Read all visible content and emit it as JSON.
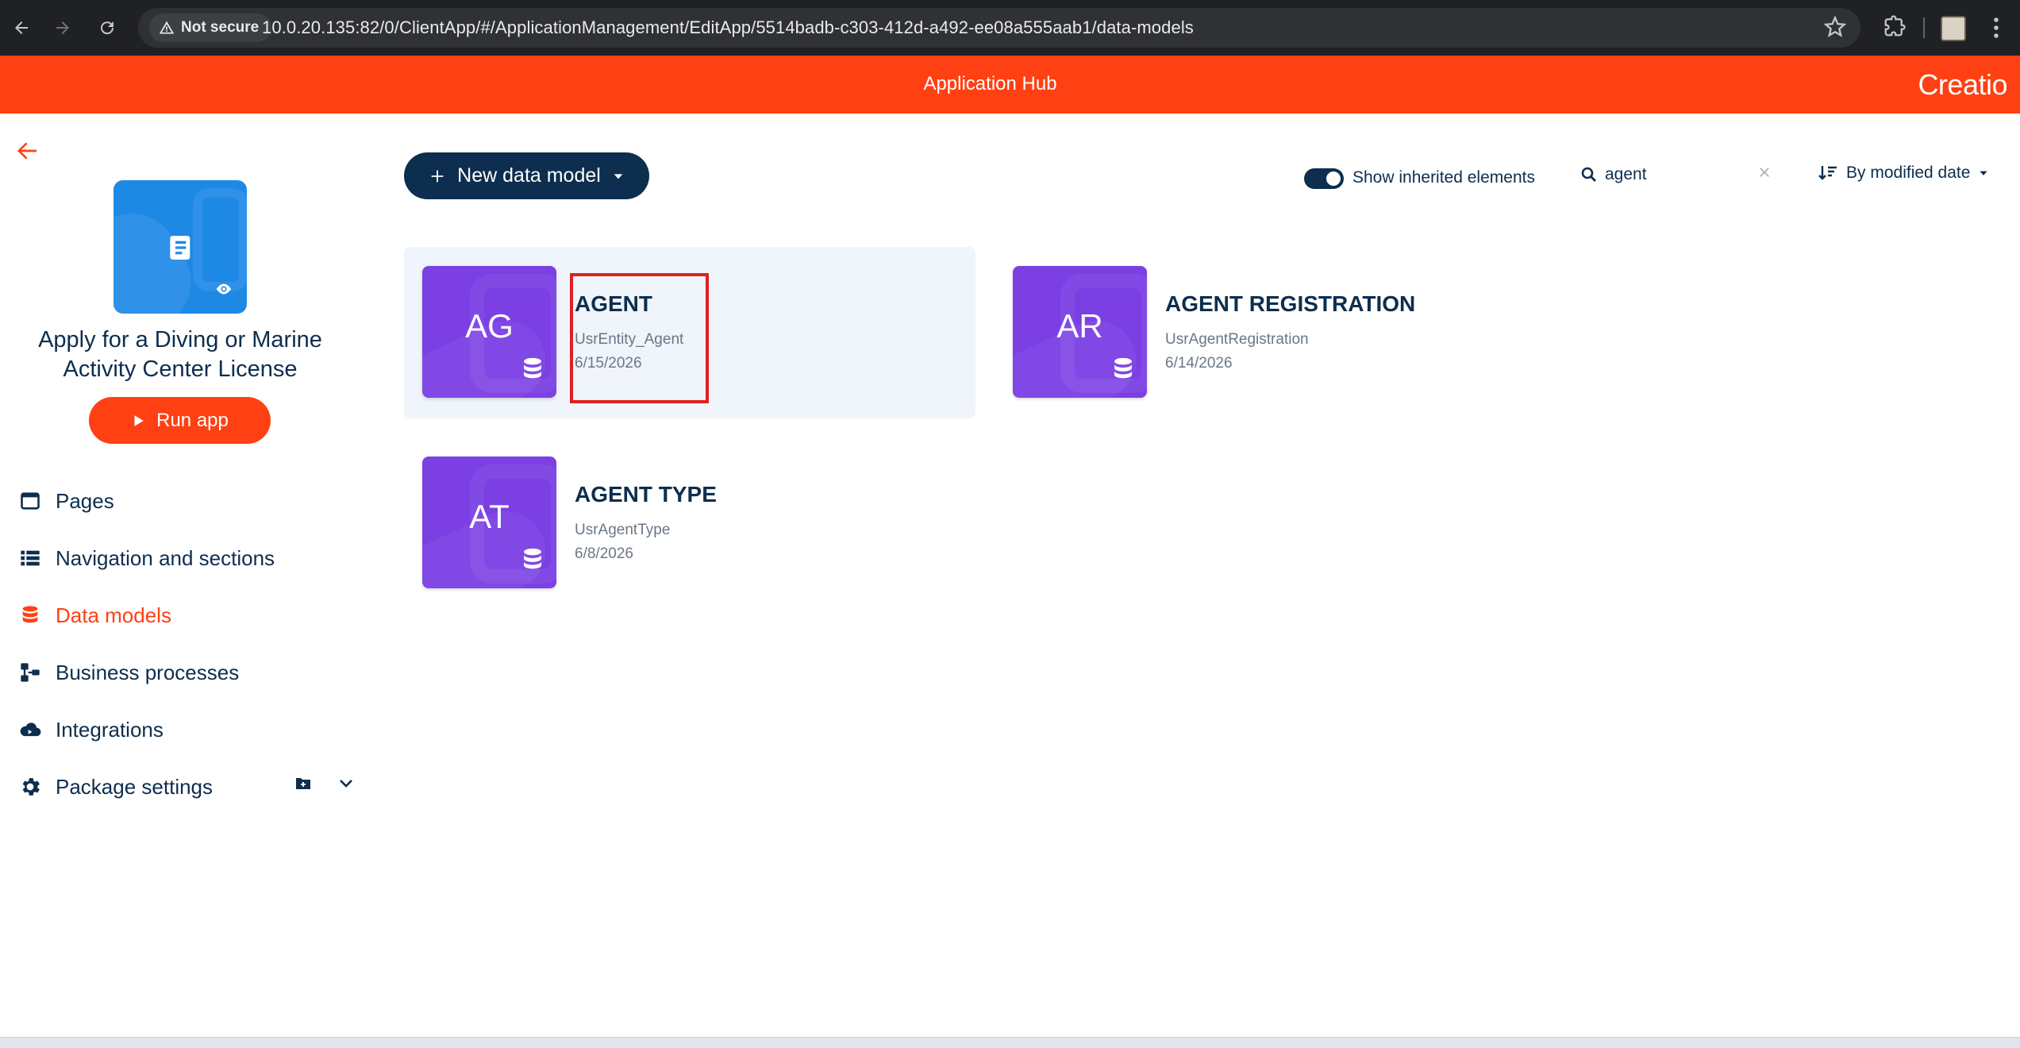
{
  "browser": {
    "security_label": "Not secure",
    "url": "10.0.20.135:82/0/ClientApp/#/ApplicationManagement/EditApp/5514badb-c303-412d-a492-ee08a555aab1/data-models"
  },
  "header": {
    "title": "Application Hub",
    "brand": "Creatio"
  },
  "app": {
    "name": "Apply for a Diving or Marine Activity Center License",
    "run_label": "Run app"
  },
  "sidebar": {
    "items": [
      {
        "label": "Pages",
        "icon": "window-icon"
      },
      {
        "label": "Navigation and sections",
        "icon": "list-icon"
      },
      {
        "label": "Data models",
        "icon": "database-icon",
        "active": true
      },
      {
        "label": "Business processes",
        "icon": "process-icon"
      },
      {
        "label": "Integrations",
        "icon": "cloud-icon"
      },
      {
        "label": "Package settings",
        "icon": "gear-icon"
      }
    ]
  },
  "toolbar": {
    "new_label": "New data model",
    "toggle_label": "Show inherited elements",
    "toggle_on": true,
    "search_value": "agent",
    "sort_label": "By modified date"
  },
  "cards": [
    {
      "initials": "AG",
      "title": "AGENT",
      "code": "UsrEntity_Agent",
      "date": "6/15/2026",
      "selected": true
    },
    {
      "initials": "AR",
      "title": "AGENT REGISTRATION",
      "code": "UsrAgentRegistration",
      "date": "6/14/2026"
    },
    {
      "initials": "AT",
      "title": "AGENT TYPE",
      "code": "UsrAgentType",
      "date": "6/8/2026"
    }
  ],
  "colors": {
    "accent": "#ff4013",
    "navy": "#0d2e4e",
    "tile": "#7b3fe4",
    "app_icon": "#1e88e5"
  }
}
